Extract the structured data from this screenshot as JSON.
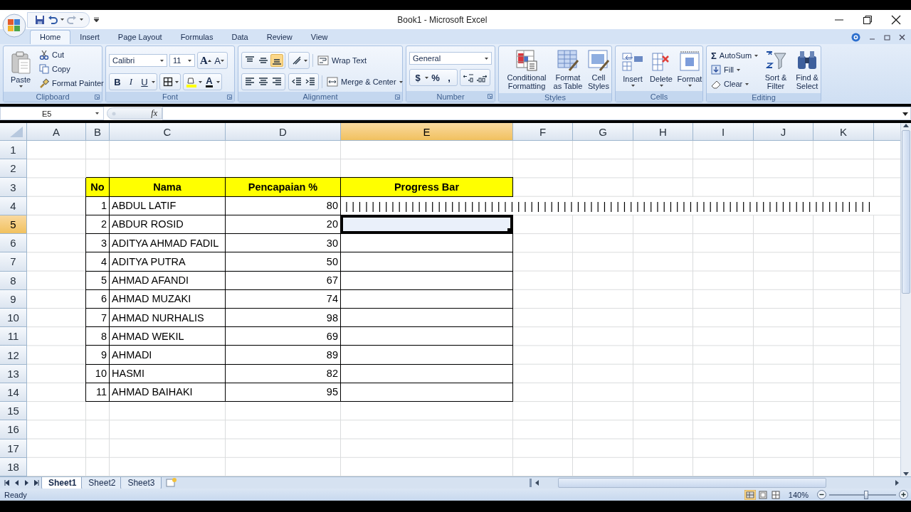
{
  "window": {
    "title": "Book1 - Microsoft Excel"
  },
  "ribbon_tabs": [
    {
      "label": "Home",
      "selected": true
    },
    {
      "label": "Insert",
      "selected": false
    },
    {
      "label": "Page Layout",
      "selected": false
    },
    {
      "label": "Formulas",
      "selected": false
    },
    {
      "label": "Data",
      "selected": false
    },
    {
      "label": "Review",
      "selected": false
    },
    {
      "label": "View",
      "selected": false
    }
  ],
  "ribbon_groups": [
    {
      "kind": "clipboard",
      "label": "Clipboard",
      "commands": [
        "Paste",
        "Cut",
        "Copy",
        "Format Painter"
      ]
    },
    {
      "kind": "font",
      "label": "Font",
      "font_name": "Calibri",
      "font_size": "11",
      "buttons": [
        "A",
        "A",
        "B",
        "I",
        "U",
        "A"
      ]
    },
    {
      "kind": "alignment",
      "label": "Alignment",
      "vertical_align": [
        {
          "selected": false
        },
        {
          "selected": false
        },
        {
          "selected": true
        }
      ],
      "commands": [
        "Wrap Text",
        "Merge & Center"
      ]
    },
    {
      "kind": "number",
      "label": "Number",
      "format": "General",
      "buttons": [
        "$",
        "%",
        ","
      ]
    },
    {
      "kind": "styles",
      "label": "Styles",
      "commands": [
        "Conditional Formatting",
        "Format as Table",
        "Cell Styles"
      ]
    },
    {
      "kind": "cells",
      "label": "Cells",
      "commands": [
        "Insert",
        "Delete",
        "Format"
      ]
    },
    {
      "kind": "editing",
      "label": "Editing",
      "sum_symbol": "Σ",
      "commands": [
        "AutoSum",
        "Fill",
        "Clear",
        "Sort & Filter",
        "Find & Select"
      ]
    }
  ],
  "formula_bar": {
    "name_box": "E5",
    "function_label": "fx"
  },
  "sheet": {
    "columns": [
      {
        "label": "A",
        "selected": false
      },
      {
        "label": "B",
        "selected": false
      },
      {
        "label": "C",
        "selected": false
      },
      {
        "label": "D",
        "selected": false
      },
      {
        "label": "E",
        "selected": true
      },
      {
        "label": "F",
        "selected": false
      },
      {
        "label": "G",
        "selected": false
      },
      {
        "label": "H",
        "selected": false
      },
      {
        "label": "I",
        "selected": false
      },
      {
        "label": "J",
        "selected": false
      },
      {
        "label": "K",
        "selected": false
      }
    ],
    "rows": [
      {
        "label": "1",
        "selected": false
      },
      {
        "label": "2",
        "selected": false
      },
      {
        "label": "3",
        "selected": false
      },
      {
        "label": "4",
        "selected": false
      },
      {
        "label": "5",
        "selected": true
      },
      {
        "label": "6",
        "selected": false
      },
      {
        "label": "7",
        "selected": false
      },
      {
        "label": "8",
        "selected": false
      },
      {
        "label": "9",
        "selected": false
      },
      {
        "label": "10",
        "selected": false
      },
      {
        "label": "11",
        "selected": false
      },
      {
        "label": "12",
        "selected": false
      },
      {
        "label": "13",
        "selected": false
      },
      {
        "label": "14",
        "selected": false
      },
      {
        "label": "15",
        "selected": false
      },
      {
        "label": "16",
        "selected": false
      },
      {
        "label": "17",
        "selected": false
      },
      {
        "label": "18",
        "selected": false
      }
    ],
    "table": {
      "header": [
        "No",
        "Nama",
        "Pencapaian %",
        "Progress Bar"
      ],
      "rows": [
        {
          "no": "1",
          "name": "ABDUL LATIF",
          "value": "80",
          "bar": "||||||||||||||||||||||||||||||||||||||||||||||||||||||||||||||||||||||||||||||||",
          "selected": false
        },
        {
          "no": "2",
          "name": "ABDUR ROSID",
          "value": "20",
          "selected": true
        },
        {
          "no": "3",
          "name": "ADITYA AHMAD FADIL",
          "value": "30",
          "selected": false
        },
        {
          "no": "4",
          "name": "ADITYA PUTRA",
          "value": "50",
          "selected": false
        },
        {
          "no": "5",
          "name": "AHMAD AFANDI",
          "value": "67",
          "selected": false
        },
        {
          "no": "6",
          "name": "AHMAD MUZAKI",
          "value": "74",
          "selected": false
        },
        {
          "no": "7",
          "name": "AHMAD NURHALIS",
          "value": "98",
          "selected": false
        },
        {
          "no": "8",
          "name": "AHMAD WEKIL",
          "value": "69",
          "selected": false
        },
        {
          "no": "9",
          "name": "AHMADI",
          "value": "89",
          "selected": false
        },
        {
          "no": "10",
          "name": "HASMI",
          "value": "82",
          "selected": false
        },
        {
          "no": "11",
          "name": "AHMAD BAIHAKI",
          "value": "95",
          "selected": false
        }
      ]
    }
  },
  "sheet_tabs": [
    {
      "label": "Sheet1",
      "selected": true
    },
    {
      "label": "Sheet2",
      "selected": false
    },
    {
      "label": "Sheet3",
      "selected": false
    }
  ],
  "status_bar": {
    "text": "Ready",
    "zoom": "140%",
    "zoom_slider": {
      "level": 0.55
    }
  }
}
